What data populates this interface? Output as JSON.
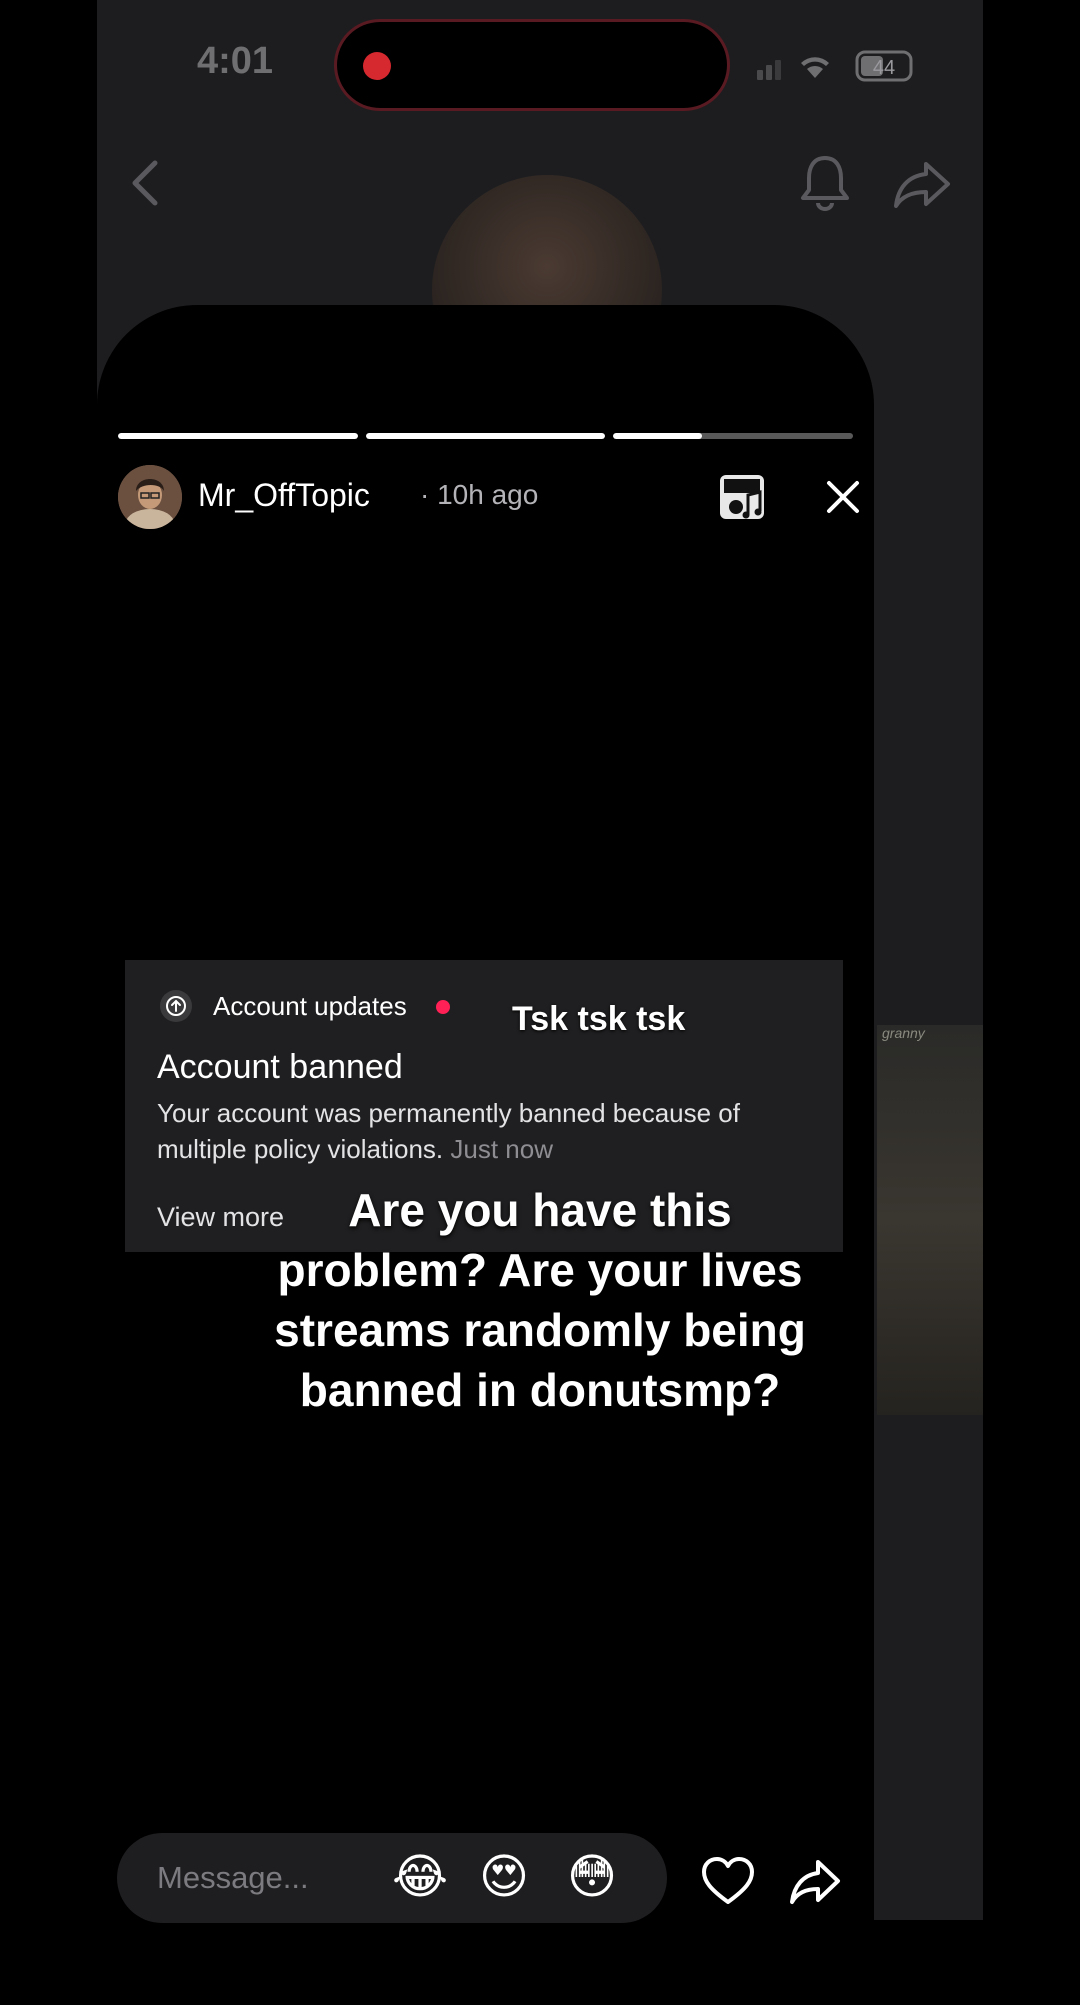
{
  "status_bar": {
    "time": "4:01",
    "battery": "44"
  },
  "story": {
    "username": "Mr_OffTopic",
    "time_ago": "· 10h ago",
    "progress": [
      1,
      1,
      0.37
    ]
  },
  "notification": {
    "category": "Account updates",
    "title": "Account banned",
    "body": "Your account was permanently banned because of multiple policy violations.",
    "time": "Just now",
    "view_more": "View more"
  },
  "captions": {
    "small": "Tsk tsk tsk",
    "big": "Are you have this problem? Are your lives streams randomly being banned in donutsmp?"
  },
  "message_bar": {
    "placeholder": "Message...",
    "emojis": [
      "😂",
      "😍",
      "😳"
    ]
  },
  "background": {
    "thumb_label": "granny"
  },
  "colors": {
    "accent_red": "#ff2056",
    "record_red": "#d5282f"
  }
}
